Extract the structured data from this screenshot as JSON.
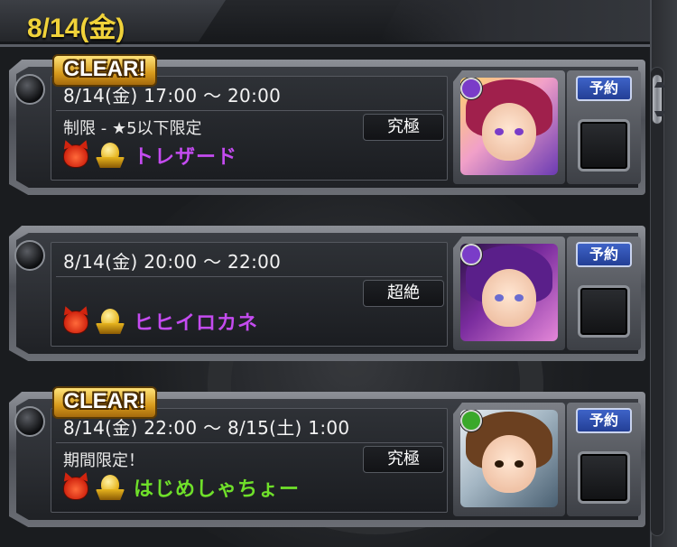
{
  "header": {
    "date": "8/14(金)"
  },
  "quests": [
    {
      "cleared": true,
      "clear_label": "CLEAR!",
      "schedule": "8/14(金) 17:00 ～ 20:00",
      "restriction": "制限 - ★5以下限定",
      "difficulty": "究極",
      "name": "トレザード",
      "name_color": "#c44bf0",
      "reserve_label": "予約",
      "portrait": {
        "badge_color": "#7a3cc8",
        "hair": "#a0204c",
        "eyes": "#7a3cc8"
      }
    },
    {
      "cleared": false,
      "clear_label": "",
      "schedule": "8/14(金) 20:00 ～ 22:00",
      "restriction": "",
      "difficulty": "超絶",
      "name": "ヒヒイロカネ",
      "name_color": "#c44bf0",
      "reserve_label": "予約",
      "portrait": {
        "badge_color": "#7a3cc8",
        "hair": "#5a1f8a",
        "eyes": "#6a6cd0"
      }
    },
    {
      "cleared": true,
      "clear_label": "CLEAR!",
      "schedule": "8/14(金) 22:00 ～ 8/15(土) 1:00",
      "restriction": "期間限定！",
      "difficulty": "究極",
      "name": "はじめしゃちょー",
      "name_color": "#6fe02a",
      "reserve_label": "予約",
      "portrait": {
        "badge_color": "#3aa82a",
        "hair": "#6b4020",
        "eyes": "#2a1808"
      }
    }
  ]
}
